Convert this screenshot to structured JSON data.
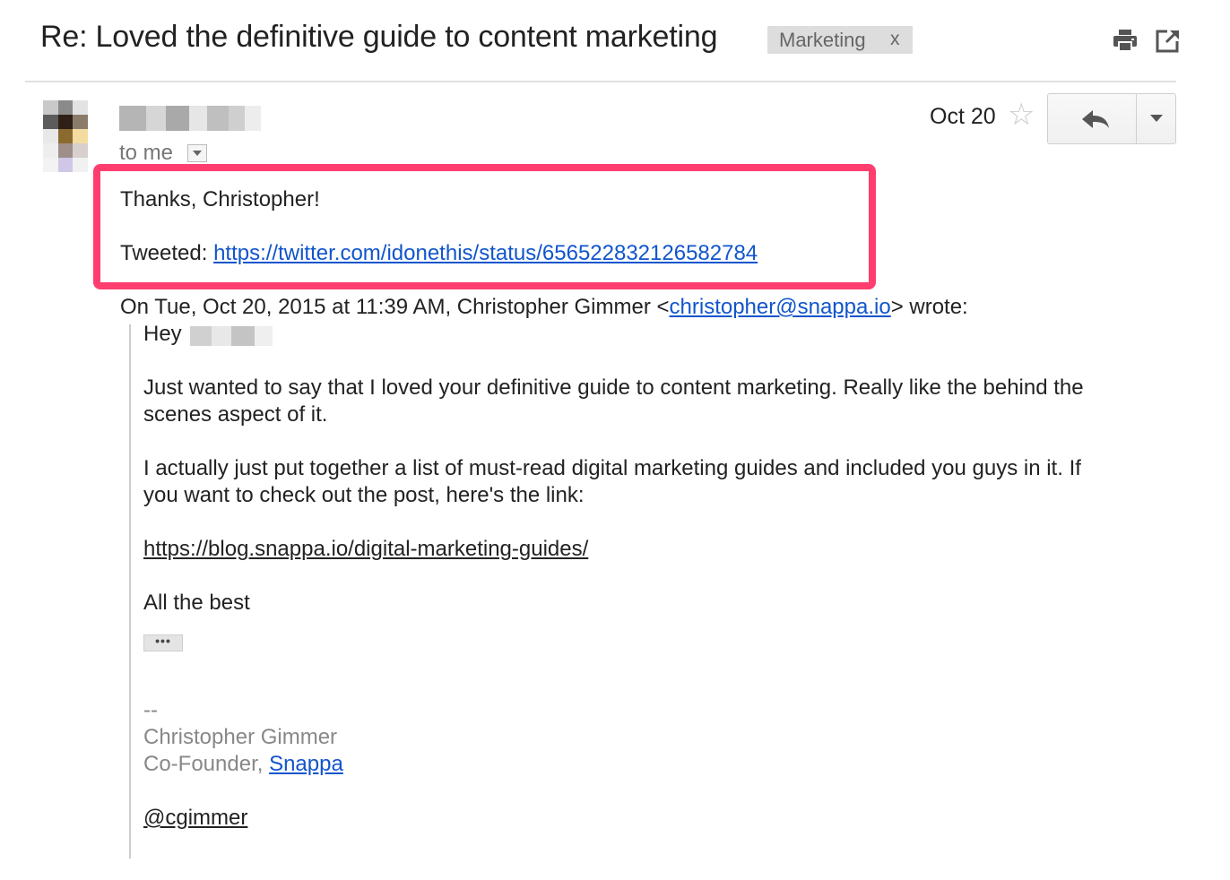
{
  "subject": "Re: Loved the definitive guide to content marketing",
  "label": {
    "name": "Marketing",
    "remove": "x"
  },
  "toolbar": {
    "print_icon": "print-icon",
    "popout_icon": "new-window-icon"
  },
  "message": {
    "to": "to me",
    "date": "Oct 20",
    "reply_icon": "reply-icon",
    "more_icon": "chevron-down-icon",
    "star_icon": "star-outline-icon",
    "reply_line1": "Thanks, Christopher!",
    "tweeted_prefix": "Tweeted: ",
    "tweeted_url": "https://twitter.com/idonethis/status/656522832126582784",
    "attribution_prefix": "On Tue, Oct 20, 2015 at 11:39 AM, Christopher Gimmer <",
    "attribution_email": "christopher@snappa.io",
    "attribution_suffix": "> wrote:"
  },
  "quoted": {
    "greeting": "Hey",
    "para1_line1": "Just wanted to say that I loved your definitive guide to content marketing. Really like the behind the",
    "para1_line2": "scenes aspect of it.",
    "para2_line1": "I actually just put together a list of must-read digital marketing guides and included you guys in it. If",
    "para2_line2": "you want to check out the post, here's the link:",
    "link": "https://blog.snappa.io/digital-marketing-guides/",
    "closing": "All the best",
    "ellipsis": "•••",
    "sig_dash": "--",
    "sig_name": "Christopher Gimmer",
    "sig_title_prefix": "Co-Founder, ",
    "sig_company": "Snappa",
    "sig_handle": "@cgimmer"
  },
  "colors": {
    "highlight": "#ff3d6e",
    "link": "#1155cc"
  }
}
